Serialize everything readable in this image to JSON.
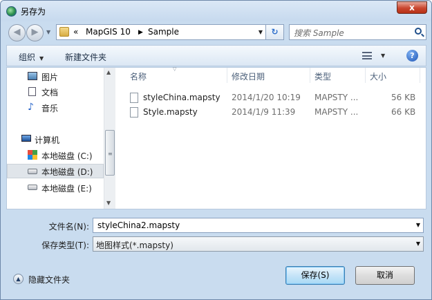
{
  "window": {
    "title": "另存为",
    "close_symbol": "x"
  },
  "address": {
    "prefix": "«",
    "crumbs": [
      "MapGIS 10",
      "Sample"
    ],
    "separator": "▶"
  },
  "search": {
    "placeholder": "搜索 Sample"
  },
  "toolbar": {
    "organize": "组织",
    "new_folder": "新建文件夹"
  },
  "nav": {
    "items": [
      {
        "label": "图片",
        "icon": "picture-icon"
      },
      {
        "label": "文档",
        "icon": "document-icon"
      },
      {
        "label": "音乐",
        "icon": "music-icon"
      },
      {
        "label": "计算机",
        "icon": "computer-icon"
      },
      {
        "label": "本地磁盘 (C:)",
        "icon": "windows-drive-icon"
      },
      {
        "label": "本地磁盘 (D:)",
        "icon": "drive-icon",
        "selected": true
      },
      {
        "label": "本地磁盘 (E:)",
        "icon": "drive-icon"
      }
    ]
  },
  "columns": {
    "name": "名称",
    "modified": "修改日期",
    "type": "类型",
    "size": "大小"
  },
  "files": [
    {
      "name": "styleChina.mapsty",
      "modified": "2014/1/20 10:19",
      "type": "MAPSTY ...",
      "size": "56 KB"
    },
    {
      "name": "Style.mapsty",
      "modified": "2014/1/9 11:39",
      "type": "MAPSTY ...",
      "size": "66 KB"
    }
  ],
  "form": {
    "filename_label": "文件名(N):",
    "filename_value": "styleChina2.mapsty",
    "filetype_label": "保存类型(T):",
    "filetype_value": "地图样式(*.mapsty)"
  },
  "footer": {
    "hide_folders": "隐藏文件夹",
    "save": "保存(S)",
    "cancel": "取消"
  }
}
